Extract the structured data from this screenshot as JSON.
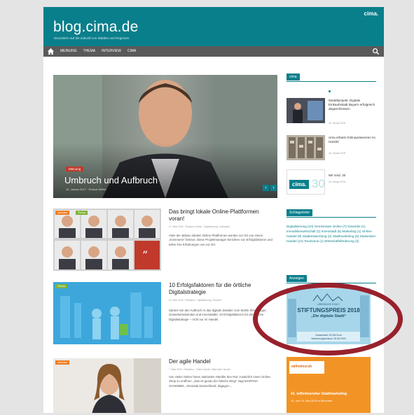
{
  "header": {
    "site_title": "blog.cima.de",
    "tagline": "Neuzeitern auf die Zukunft von Städten und Regionen",
    "logo": "cima."
  },
  "nav": {
    "items": [
      "MEINUNG",
      "THEMA",
      "INTERVIEW",
      "CIMA"
    ],
    "home_icon": "home-icon",
    "search_icon": "search-icon"
  },
  "hero": {
    "badge": "Meinung",
    "title": "Umbruch und Aufbruch",
    "meta": "16. Januar 2017 · Roland Wölfel",
    "prev": "‹",
    "next": "›"
  },
  "posts": [
    {
      "title": "Das bringt lokale Online-Plattformen voran!",
      "tags": [
        "Interview",
        "Thema"
      ],
      "meta": "27. März 2018 · Christian Lindner · Digitalisierung, Innenstadt",
      "excerpt": "Viele der aktiven lokalen Online-Plattformen werden vor Ort von einem „Kümmerer“ betreut. Diese Projektmanager berichten von Erfolgsfaktoren und teilen ihre Erfahrungen von vor Ort."
    },
    {
      "title": "10 Erfolgsfaktoren für die örtliche Digitalstrategie",
      "tags": [
        "Thema"
      ],
      "meta": "21. März 2018 · Redaktion · Digitalisierung, Gewerbe",
      "excerpt": "Starten Sie den Aufbruch in das digitale Zeitalter zum Wohle Ihrer Bürger, Gewerbetreibenden und Innenstädte: 10 Erfolgsfaktoren für die örtliche Digitalstrategie – nicht nur im Handel."
    },
    {
      "title": "Der agile Handel",
      "tags": [
        "Interview"
      ],
      "meta": "7. März 2018 · Redaktion · Online-Handel, Stationärer Handel",
      "excerpt": "Von vielen Seiten hören stationäre Händler den Rat, zusätzlich einen Online-Shop zu eröffnen. „Das ist genau der falsche Weg!“ sagt MARTINA SCHIMMEL, Zentrada Deutschland, dagegen..."
    }
  ],
  "sidebar": {
    "widget1_title": "cima",
    "side_posts": [
      {
        "title": "Modellprojekt: Digitale Einkaufsstadt Bayern erfolgreich abgeschlossen",
        "date": "26. Januar 2018"
      },
      {
        "title": "cima erfasst Onlinepräsenzen im Handel",
        "date": "18. Januar 2018"
      },
      {
        "title": "Wir sind: 30",
        "date": "15. Januar 2018"
      }
    ],
    "side_post3_logo": "cima.",
    "side_post3_logo_num": "30",
    "widget2_title": "Schlagwörter",
    "tags_cloud": "Digitalisierung (10) Gemeinsam Online (7) Gewerbe (1) Immobilienwirtschaft (2) Innenstadt (5) Marketing (1) Online-Handel (9) Stadtentwicklung (2) Stadtmarketing (5) Stationärer Handel (12) Tourismus (1) Wirtschaftsförderung (2)",
    "widget3_title": "Anzeigen",
    "ad1": {
      "kicker": "LEBENDIGE STADT",
      "title": "STIFTUNGSPREIS 2018",
      "subtitle": "„Die digitale Stadt“",
      "line1": "Gesamtwert 15.000 Euro",
      "line2": "Bewerbungsschluss: 30.06.2018"
    },
    "ad2": {
      "logo": "wilhelmsruh",
      "headline": "41. wilhelmsruher Stadtmarketing",
      "date": "14. und 15. Mai 2018 in München"
    }
  },
  "colors": {
    "brand": "#0a7f8c",
    "highlight_ring": "#98212d",
    "nav": "#5a5a5a",
    "badge_red": "#c0392b",
    "tag_orange": "#f07c1e",
    "tag_green": "#7fb539"
  }
}
